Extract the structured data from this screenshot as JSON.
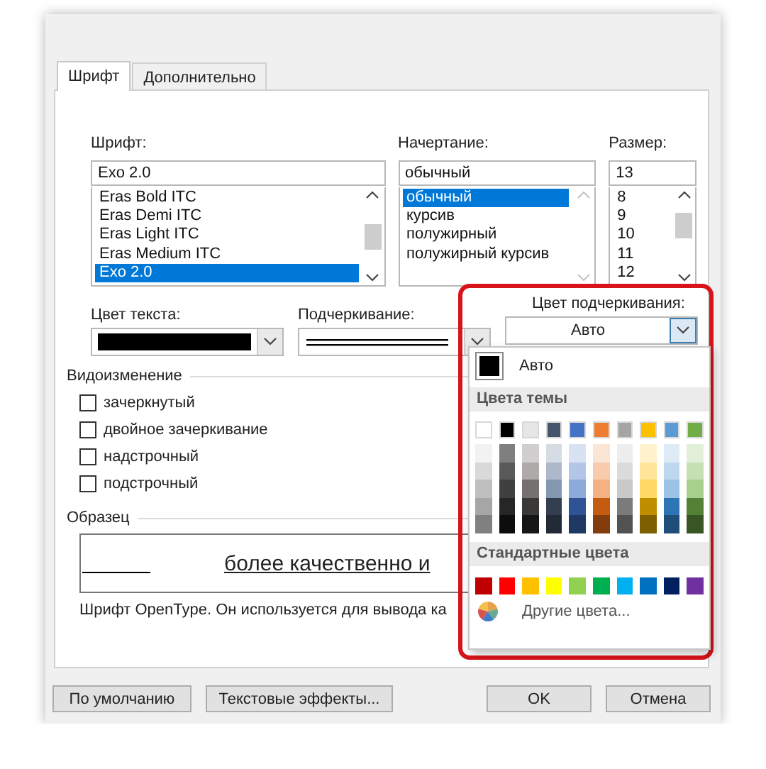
{
  "tabs": [
    {
      "label": "Шрифт",
      "selected": true
    },
    {
      "label": "Дополнительно",
      "selected": false
    }
  ],
  "font": {
    "label": "Шрифт:",
    "value": "Exo 2.0",
    "items": [
      {
        "label": "Eras Bold ITC",
        "selected": false
      },
      {
        "label": "Eras Demi ITC",
        "selected": false
      },
      {
        "label": "Eras Light ITC",
        "selected": false
      },
      {
        "label": "Eras Medium ITC",
        "selected": false
      },
      {
        "label": "Exo 2.0",
        "selected": true
      }
    ]
  },
  "style": {
    "label": "Начертание:",
    "value": "обычный",
    "items": [
      {
        "label": "обычный",
        "selected": true
      },
      {
        "label": "курсив",
        "selected": false
      },
      {
        "label": "полужирный",
        "selected": false
      },
      {
        "label": "полужирный курсив",
        "selected": false
      }
    ]
  },
  "size": {
    "label": "Размер:",
    "value": "13",
    "items": [
      {
        "label": "8",
        "selected": false
      },
      {
        "label": "9",
        "selected": false
      },
      {
        "label": "10",
        "selected": false
      },
      {
        "label": "11",
        "selected": false
      },
      {
        "label": "12",
        "selected": false
      }
    ]
  },
  "text_color": {
    "label": "Цвет текста:",
    "color": "#000000"
  },
  "underline": {
    "label": "Подчеркивание:"
  },
  "underline_color": {
    "label": "Цвет подчеркивания:",
    "value": "Авто",
    "expanded": true
  },
  "color_menu": {
    "auto": {
      "label": "Авто",
      "color": "#000000"
    },
    "theme_heading": "Цвета темы",
    "theme_colors": [
      {
        "color": "#ffffff",
        "shades": [
          {
            "color": "#f2f2f2"
          },
          {
            "color": "#d9d9d9"
          },
          {
            "color": "#bfbfbf"
          },
          {
            "color": "#a6a6a6"
          },
          {
            "color": "#808080"
          }
        ]
      },
      {
        "color": "#000000",
        "shades": [
          {
            "color": "#7f7f7f"
          },
          {
            "color": "#595959"
          },
          {
            "color": "#404040"
          },
          {
            "color": "#262626"
          },
          {
            "color": "#0d0d0d"
          }
        ]
      },
      {
        "color": "#e7e6e6",
        "shades": [
          {
            "color": "#d0cece"
          },
          {
            "color": "#aeaaaa"
          },
          {
            "color": "#757171"
          },
          {
            "color": "#3b3838"
          },
          {
            "color": "#171616"
          }
        ]
      },
      {
        "color": "#44546a",
        "shades": [
          {
            "color": "#d6dce4"
          },
          {
            "color": "#adb9ca"
          },
          {
            "color": "#8497b0"
          },
          {
            "color": "#333f4f"
          },
          {
            "color": "#222a35"
          }
        ]
      },
      {
        "color": "#4472c4",
        "shades": [
          {
            "color": "#d9e2f3"
          },
          {
            "color": "#b4c6e7"
          },
          {
            "color": "#8eaadb"
          },
          {
            "color": "#2f5496"
          },
          {
            "color": "#1f3864"
          }
        ]
      },
      {
        "color": "#ed7d31",
        "shades": [
          {
            "color": "#fbe5d5"
          },
          {
            "color": "#f7cbac"
          },
          {
            "color": "#f4b183"
          },
          {
            "color": "#c55a11"
          },
          {
            "color": "#833c0b"
          }
        ]
      },
      {
        "color": "#a5a5a5",
        "shades": [
          {
            "color": "#ededed"
          },
          {
            "color": "#dbdbdb"
          },
          {
            "color": "#c9c9c9"
          },
          {
            "color": "#7b7b7b"
          },
          {
            "color": "#525252"
          }
        ]
      },
      {
        "color": "#ffc000",
        "shades": [
          {
            "color": "#fff2cc"
          },
          {
            "color": "#fee599"
          },
          {
            "color": "#ffd965"
          },
          {
            "color": "#bf8f00"
          },
          {
            "color": "#7f6000"
          }
        ]
      },
      {
        "color": "#5b9bd5",
        "shades": [
          {
            "color": "#deebf6"
          },
          {
            "color": "#bdd7ee"
          },
          {
            "color": "#9cc3e5"
          },
          {
            "color": "#2e75b5"
          },
          {
            "color": "#1e4e79"
          }
        ]
      },
      {
        "color": "#70ad47",
        "shades": [
          {
            "color": "#e2efd9"
          },
          {
            "color": "#c5e0b3"
          },
          {
            "color": "#a8d08d"
          },
          {
            "color": "#538135"
          },
          {
            "color": "#375623"
          }
        ]
      }
    ],
    "standard_heading": "Стандартные цвета",
    "standard_colors": [
      {
        "color": "#c00000"
      },
      {
        "color": "#ff0000"
      },
      {
        "color": "#ffc000"
      },
      {
        "color": "#ffff00"
      },
      {
        "color": "#92d050"
      },
      {
        "color": "#00b050"
      },
      {
        "color": "#00b0f0"
      },
      {
        "color": "#0070c0"
      },
      {
        "color": "#002060"
      },
      {
        "color": "#7030a0"
      }
    ],
    "more": "Другие цвета..."
  },
  "effects": {
    "heading": "Видоизменение",
    "options": [
      {
        "label": "зачеркнутый",
        "checked": false
      },
      {
        "label": "двойное зачеркивание",
        "checked": false
      },
      {
        "label": "надстрочный",
        "checked": false
      },
      {
        "label": "подстрочный",
        "checked": false
      }
    ]
  },
  "sample": {
    "heading": "Образец",
    "text": "более качественно и",
    "note": "Шрифт OpenType. Он используется для вывода ка"
  },
  "buttons": [
    "По умолчанию",
    "Текстовые эффекты...",
    "OK",
    "Отмена"
  ]
}
